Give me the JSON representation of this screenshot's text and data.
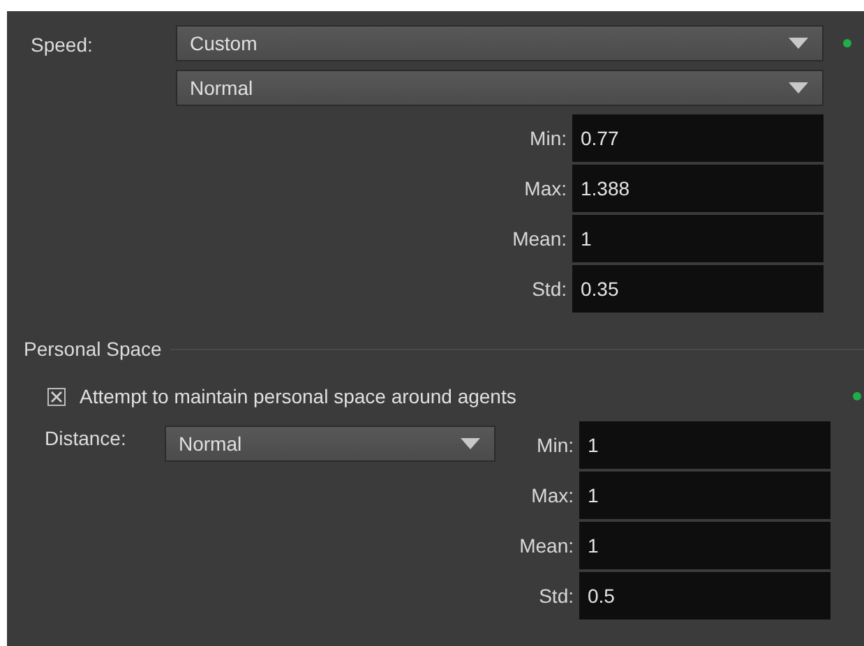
{
  "speed": {
    "label": "Speed:",
    "preset": "Custom",
    "distribution": "Normal",
    "fields": [
      {
        "label": "Min:",
        "value": "0.77"
      },
      {
        "label": "Max:",
        "value": "1.388"
      },
      {
        "label": "Mean:",
        "value": "1"
      },
      {
        "label": "Std:",
        "value": "0.35"
      }
    ]
  },
  "personal_space": {
    "title": "Personal Space",
    "checkbox": {
      "label": "Attempt to maintain personal space around agents",
      "checked": true
    },
    "distance": {
      "label": "Distance:",
      "value": "Normal"
    },
    "fields": [
      {
        "label": "Min:",
        "value": "1"
      },
      {
        "label": "Max:",
        "value": "1"
      },
      {
        "label": "Mean:",
        "value": "1"
      },
      {
        "label": "Std:",
        "value": "0.5"
      }
    ]
  }
}
